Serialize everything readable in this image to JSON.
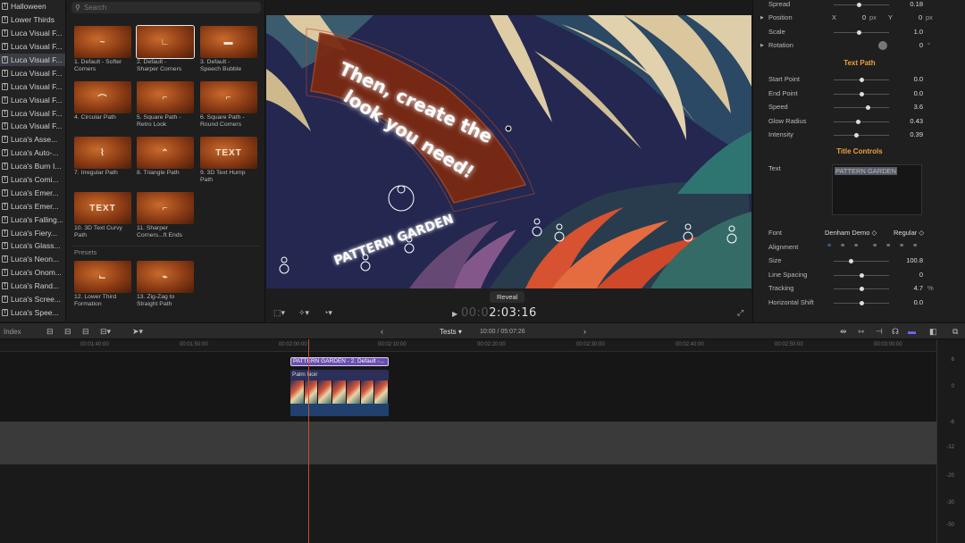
{
  "sidebar": {
    "items": [
      {
        "label": "Halloween"
      },
      {
        "label": "Lower Thirds"
      },
      {
        "label": "Luca Visual F..."
      },
      {
        "label": "Luca Visual F..."
      },
      {
        "label": "Luca Visual F...",
        "selected": true
      },
      {
        "label": "Luca Visual F..."
      },
      {
        "label": "Luca Visual F..."
      },
      {
        "label": "Luca Visual F..."
      },
      {
        "label": "Luca Visual F..."
      },
      {
        "label": "Luca Visual F..."
      },
      {
        "label": "Luca's Asse..."
      },
      {
        "label": "Luca's Auto-..."
      },
      {
        "label": "Luca's Burn I..."
      },
      {
        "label": "Luca's Comi..."
      },
      {
        "label": "Luca's Emer..."
      },
      {
        "label": "Luca's Emer..."
      },
      {
        "label": "Luca's Falling..."
      },
      {
        "label": "Luca's Fiery..."
      },
      {
        "label": "Luca's Glass..."
      },
      {
        "label": "Luca's Neon..."
      },
      {
        "label": "Luca's Onom..."
      },
      {
        "label": "Luca's Rand..."
      },
      {
        "label": "Luca's Scree..."
      },
      {
        "label": "Luca's Spee..."
      }
    ]
  },
  "browser": {
    "search_placeholder": "Search",
    "thumbnails": [
      {
        "caption1": "1. Default - Softer",
        "caption2": "Corners",
        "glyph": "~"
      },
      {
        "caption1": "2. Default -",
        "caption2": "Sharper Corners",
        "glyph": "∟",
        "selected": true
      },
      {
        "caption1": "3. Default -",
        "caption2": "Speech Bubble",
        "glyph": "▬"
      },
      {
        "caption1": "4. Circular Path",
        "caption2": "",
        "glyph": "⌒"
      },
      {
        "caption1": "5. Square Path -",
        "caption2": "Retro Look",
        "glyph": "⌐"
      },
      {
        "caption1": "6. Square Path -",
        "caption2": "Round Corners",
        "glyph": "⌐"
      },
      {
        "caption1": "7. Irregular Path",
        "caption2": "",
        "glyph": "⌇"
      },
      {
        "caption1": "8. Triangle Path",
        "caption2": "",
        "glyph": "⌃"
      },
      {
        "caption1": "9. 3D Text Hump",
        "caption2": "Path",
        "glyph": "TEXT"
      },
      {
        "caption1": "10. 3D Text Curvy",
        "caption2": "Path",
        "glyph": "TEXT"
      },
      {
        "caption1": "11. Sharper",
        "caption2": "Corners...ft Ends",
        "glyph": "⌐"
      }
    ],
    "presets_label": "Presets",
    "presets": [
      {
        "caption1": "12. Lower Third",
        "caption2": "Formation",
        "glyph": "⌙"
      },
      {
        "caption1": "13. Zig-Zag to",
        "caption2": "Straight Path",
        "glyph": "⌁"
      }
    ]
  },
  "viewer": {
    "overlay_line1": "Then, create the",
    "overlay_line2": "look you need!",
    "path_text": "PATTERN GARDEN",
    "reveal_label": "Reveal",
    "timecode_dim": "00:0",
    "timecode": "2:03:16"
  },
  "inspector": {
    "rows_top": [
      {
        "label": "Spread",
        "value": "0.18",
        "knob": 0.18
      },
      {
        "label": "Position",
        "x_label": "X",
        "x_value": "0",
        "x_unit": "px",
        "y_label": "Y",
        "y_value": "0",
        "y_unit": "px",
        "expand": true
      },
      {
        "label": "Scale",
        "value": "1.0",
        "knob": 0.5
      },
      {
        "label": "Rotation",
        "value": "0",
        "unit": "°",
        "expand": true
      }
    ],
    "section_text_path": "Text Path",
    "rows_path": [
      {
        "label": "Start Point",
        "value": "0.0",
        "knob": 0.5
      },
      {
        "label": "End Point",
        "value": "0.0",
        "knob": 0.5
      },
      {
        "label": "Speed",
        "value": "3.6",
        "knob": 0.62
      },
      {
        "label": "Glow Radius",
        "value": "0.43",
        "knob": 0.43
      },
      {
        "label": "Intensity",
        "value": "0.39",
        "knob": 0.39
      }
    ],
    "section_title_controls": "Title Controls",
    "text_label": "Text",
    "text_value": "PATTERN GARDEN",
    "font_label": "Font",
    "font_name": "Denham Demo ◇",
    "font_style": "Regular ◇",
    "alignment_label": "Alignment",
    "rows_bottom": [
      {
        "label": "Size",
        "value": "100.8",
        "knob": 0.3
      },
      {
        "label": "Line Spacing",
        "value": "0",
        "knob": 0.5
      },
      {
        "label": "Tracking",
        "value": "4.7",
        "unit": "%",
        "knob": 0.5
      },
      {
        "label": "Horizontal Shift",
        "value": "0.0",
        "knob": 0.5
      }
    ]
  },
  "timeline": {
    "index_label": "Index",
    "project_name": "Tests",
    "duration": "10:00 / 05:07:26",
    "ruler": [
      "00:01:40:00",
      "00:01:50:00",
      "00:02:00:00",
      "00:02:10:00",
      "00:02:20:00",
      "00:02:30:00",
      "00:02:40:00",
      "00:02:50:00",
      "00:03:00:00"
    ],
    "title_clip": "PATTERN GARDEN - 2. Default -...",
    "video_clip": "Palm Noir",
    "meter_labels": [
      "6",
      "0",
      "-6",
      "-12",
      "-20",
      "-30",
      "-50"
    ]
  },
  "colors": {
    "accent": "#e8a23c",
    "panel": "#1f1f1f",
    "title_clip": "#6b4db0",
    "playhead": "#c0502c"
  }
}
